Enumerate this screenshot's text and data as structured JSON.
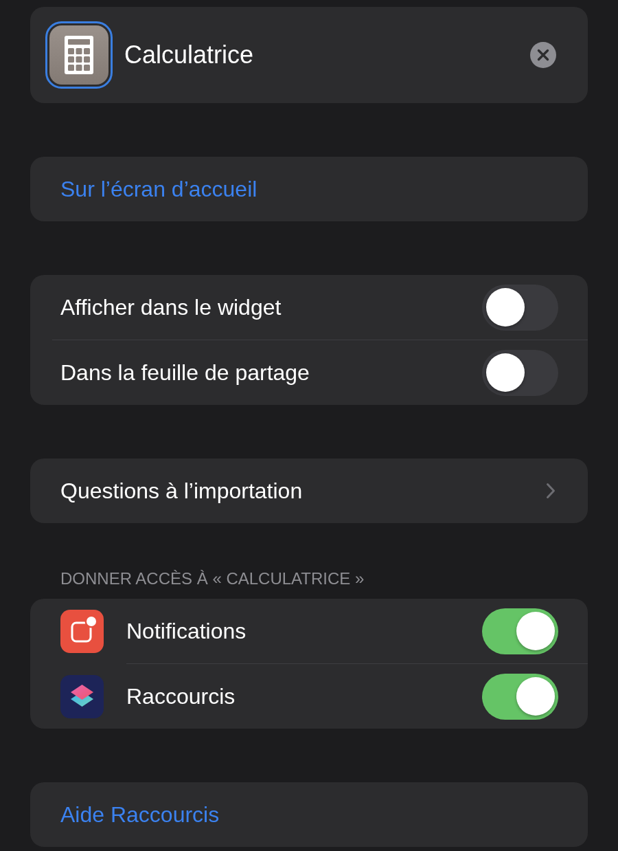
{
  "shortcut": {
    "name": "Calculatrice",
    "icon_selected": true
  },
  "home_screen_link": "Sur l’écran d’accueil",
  "options": [
    {
      "label": "Afficher dans le widget",
      "on": false
    },
    {
      "label": "Dans la feuille de partage",
      "on": false
    }
  ],
  "import_questions": {
    "label": "Questions à l’importation"
  },
  "access": {
    "header": "DONNER ACCÈS À « CALCULATRICE »",
    "items": [
      {
        "kind": "notifications",
        "label": "Notifications",
        "on": true
      },
      {
        "kind": "shortcuts",
        "label": "Raccourcis",
        "on": true
      }
    ]
  },
  "help_link": "Aide Raccourcis"
}
